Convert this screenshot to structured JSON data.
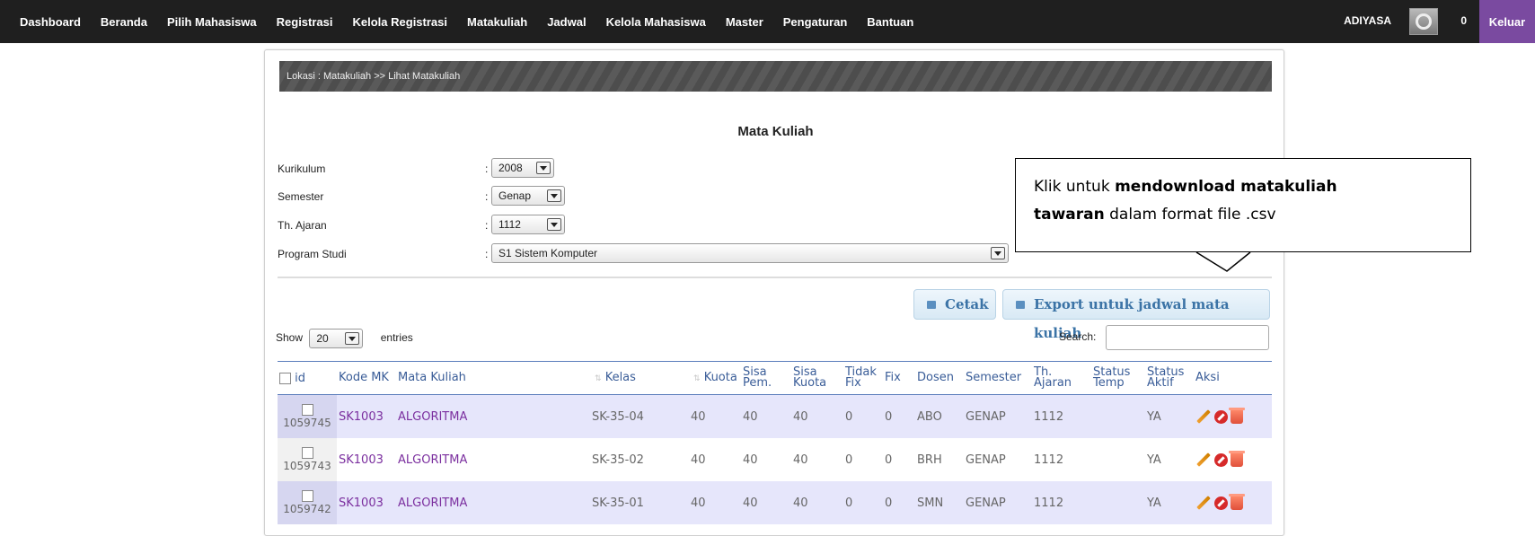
{
  "nav": {
    "items": [
      "Dashboard",
      "Beranda",
      "Pilih Mahasiswa",
      "Registrasi",
      "Kelola Registrasi",
      "Matakuliah",
      "Jadwal",
      "Kelola Mahasiswa",
      "Master",
      "Pengaturan",
      "Bantuan"
    ],
    "user": "ADIYASA",
    "notif_count": "0",
    "logout": "Keluar",
    "avatar_icon": "gear-icon"
  },
  "breadcrumb": "Lokasi : Matakuliah >> Lihat Matakuliah",
  "page_title": "Mata Kuliah",
  "filters": {
    "kurikulum": {
      "label": "Kurikulum",
      "value": "2008"
    },
    "semester": {
      "label": "Semester",
      "value": "Genap"
    },
    "th_ajaran": {
      "label": "Th. Ajaran",
      "value": "1112"
    },
    "prodi": {
      "label": "Program Studi",
      "value": "S1 Sistem Komputer"
    },
    "colon": ":"
  },
  "buttons": {
    "cetak": "Cetak",
    "export": "Export untuk jadwal mata kuliah"
  },
  "show": {
    "prefix": "Show",
    "value": "20",
    "suffix": "entries"
  },
  "search": {
    "label": "Search:",
    "value": ""
  },
  "table": {
    "headers": {
      "id": "id",
      "kode": "Kode MK",
      "mk": "Mata Kuliah",
      "kelas": "Kelas",
      "kuota": "Kuota",
      "sisa_pem_1": "Sisa",
      "sisa_pem_2": "Pem.",
      "sisa_kuota_1": "Sisa",
      "sisa_kuota_2": "Kuota",
      "tidak_fix_1": "Tidak",
      "tidak_fix_2": "Fix",
      "fix": "Fix",
      "dosen": "Dosen",
      "semester": "Semester",
      "th_ajaran_1": "Th.",
      "th_ajaran_2": "Ajaran",
      "status_temp_1": "Status",
      "status_temp_2": "Temp",
      "status_aktif_1": "Status",
      "status_aktif_2": "Aktif",
      "aksi": "Aksi"
    },
    "rows": [
      {
        "id": "1059745",
        "kode": "SK1003",
        "mk": "ALGORITMA",
        "kelas": "SK-35-04",
        "kuota": "40",
        "sisa_pem": "40",
        "sisa_kuota": "40",
        "tidak_fix": "0",
        "fix": "0",
        "dosen": "ABO",
        "semester": "GENAP",
        "th_ajaran": "1112",
        "status_temp": "",
        "status_aktif": "YA"
      },
      {
        "id": "1059743",
        "kode": "SK1003",
        "mk": "ALGORITMA",
        "kelas": "SK-35-02",
        "kuota": "40",
        "sisa_pem": "40",
        "sisa_kuota": "40",
        "tidak_fix": "0",
        "fix": "0",
        "dosen": "BRH",
        "semester": "GENAP",
        "th_ajaran": "1112",
        "status_temp": "",
        "status_aktif": "YA"
      },
      {
        "id": "1059742",
        "kode": "SK1003",
        "mk": "ALGORITMA",
        "kelas": "SK-35-01",
        "kuota": "40",
        "sisa_pem": "40",
        "sisa_kuota": "40",
        "tidak_fix": "0",
        "fix": "0",
        "dosen": "SMN",
        "semester": "GENAP",
        "th_ajaran": "1112",
        "status_temp": "",
        "status_aktif": "YA"
      }
    ]
  },
  "callout": {
    "t1": "Klik untuk ",
    "b1": "mendownload matakuliah",
    "b2": "tawaran",
    "t2": " dalam format file .csv"
  },
  "colors": {
    "topbar": "#1f1f1f",
    "logout": "#7a4aa0",
    "link": "#7b2f9f",
    "header": "#3a5d98"
  }
}
